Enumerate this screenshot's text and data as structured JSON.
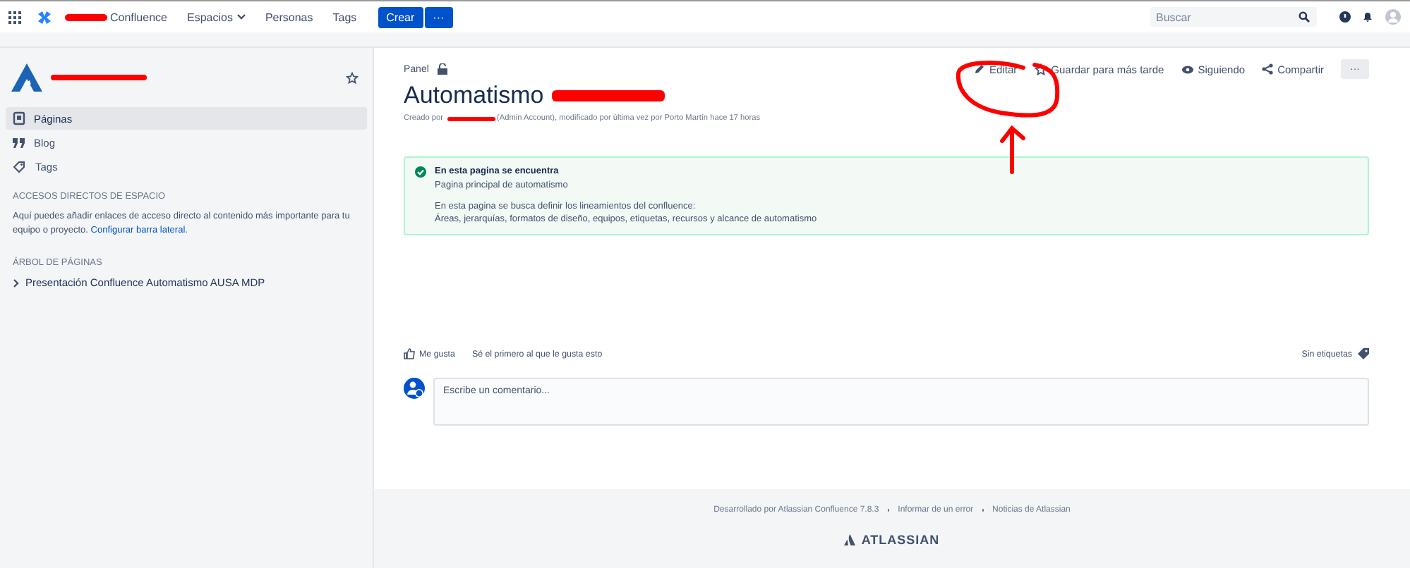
{
  "top_nav": {
    "menu": [
      {
        "label": "Confluence",
        "dropdown": false
      },
      {
        "label": "Espacios",
        "dropdown": true
      },
      {
        "label": "Personas",
        "dropdown": false
      },
      {
        "label": "Tags",
        "dropdown": false
      }
    ],
    "create_button": "Crear",
    "more_button": "···",
    "search": {
      "placeholder": "Buscar"
    }
  },
  "sidebar": {
    "nav": [
      {
        "label": "Páginas",
        "selected": true
      },
      {
        "label": "Blog",
        "selected": false
      },
      {
        "label": "Tags",
        "selected": false
      }
    ],
    "shortcuts": {
      "heading": "ACCESOS DIRECTOS DE ESPACIO",
      "text": "Aquí puedes añadir enlaces de acceso directo al contenido más importante para tu equipo o proyecto.",
      "link": "Configurar barra lateral."
    },
    "tree": {
      "heading": "ÁRBOL DE PÁGINAS",
      "items": [
        {
          "label": "Presentación Confluence Automatismo AUSA MDP",
          "expanded": false
        }
      ]
    }
  },
  "page": {
    "breadcrumb": "Panel",
    "title": "Automatismo",
    "byline_start": "Creado por",
    "byline_end": "(Admin Account), modificado por última vez por Porto Martín hace 17 horas",
    "actions": [
      "Editar",
      "Guardar para más tarde",
      "Siguiendo",
      "Compartir"
    ],
    "more_button": "···",
    "panel": {
      "title": "En esta pagina se encuentra",
      "subtitle": "Pagina principal de automatismo",
      "lines": [
        "En esta pagina se busca definir los lineamientos del confluence:",
        "Áreas, jerarquías, formatos de diseño, equipos, etiquetas, recursos y alcance de automatismo"
      ]
    },
    "like_button": "Me gusta",
    "like_text": "Sé el primero al que le gusta esto",
    "labels": "Sin etiquetas",
    "comment": {
      "placeholder": "Escribe un comentario..."
    }
  },
  "footer": {
    "links": [
      "Desarrollado por Atlassian Confluence 7.8.3",
      "Informar de un error",
      "Noticias de Atlassian"
    ],
    "logo": "ATLASSIAN"
  }
}
